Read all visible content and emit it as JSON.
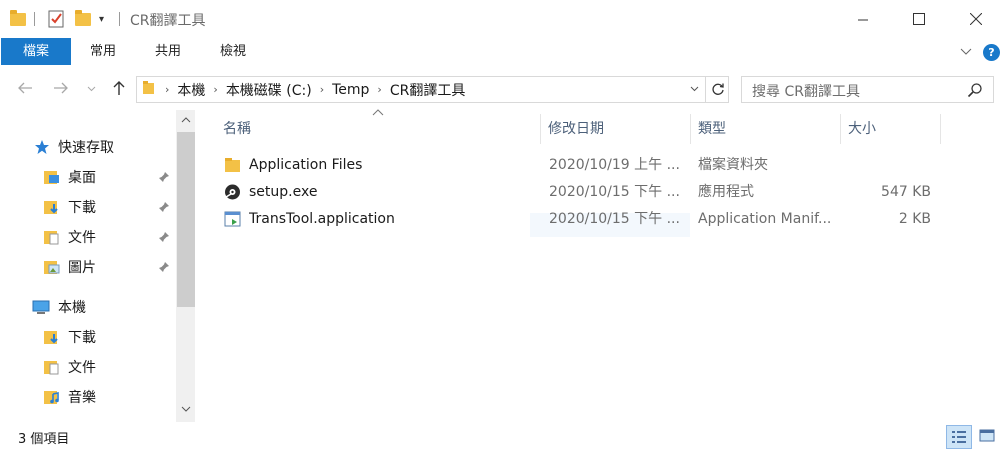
{
  "window": {
    "title": "CR翻譯工具",
    "minimize_icon": "minimize-icon",
    "maximize_icon": "maximize-icon",
    "close_icon": "close-icon"
  },
  "ribbon": {
    "tabs": [
      {
        "label": "檔案",
        "active": true
      },
      {
        "label": "常用",
        "active": false
      },
      {
        "label": "共用",
        "active": false
      },
      {
        "label": "檢視",
        "active": false
      }
    ]
  },
  "address": {
    "breadcrumbs": [
      "本機",
      "本機磁碟 (C:)",
      "Temp",
      "CR翻譯工具"
    ]
  },
  "search": {
    "placeholder": "搜尋 CR翻譯工具"
  },
  "navpane": {
    "quick_access": {
      "label": "快速存取",
      "icon": "star-icon"
    },
    "quick_items": [
      {
        "label": "桌面",
        "icon": "desktop-folder-icon",
        "pinned": true
      },
      {
        "label": "下載",
        "icon": "downloads-folder-icon",
        "pinned": true
      },
      {
        "label": "文件",
        "icon": "documents-folder-icon",
        "pinned": true
      },
      {
        "label": "圖片",
        "icon": "pictures-folder-icon",
        "pinned": true
      }
    ],
    "this_pc": {
      "label": "本機",
      "icon": "computer-icon"
    },
    "pc_items": [
      {
        "label": "下載",
        "icon": "downloads-folder-icon"
      },
      {
        "label": "文件",
        "icon": "documents-folder-icon"
      },
      {
        "label": "音樂",
        "icon": "music-folder-icon"
      }
    ]
  },
  "columns": {
    "name": "名稱",
    "date": "修改日期",
    "type": "類型",
    "size": "大小"
  },
  "files": [
    {
      "name": "Application Files",
      "date": "2020/10/19 上午 ...",
      "type": "檔案資料夾",
      "size": "",
      "icon": "folder-icon"
    },
    {
      "name": "setup.exe",
      "date": "2020/10/15 下午 ...",
      "type": "應用程式",
      "size": "547 KB",
      "icon": "setup-exe-icon"
    },
    {
      "name": "TransTool.application",
      "date": "2020/10/15 下午 ...",
      "type": "Application Manif...",
      "size": "2 KB",
      "icon": "application-manifest-icon"
    }
  ],
  "status": {
    "item_count": "3 個項目"
  },
  "colors": {
    "accent": "#1979ca",
    "folder": "#f3c146"
  }
}
